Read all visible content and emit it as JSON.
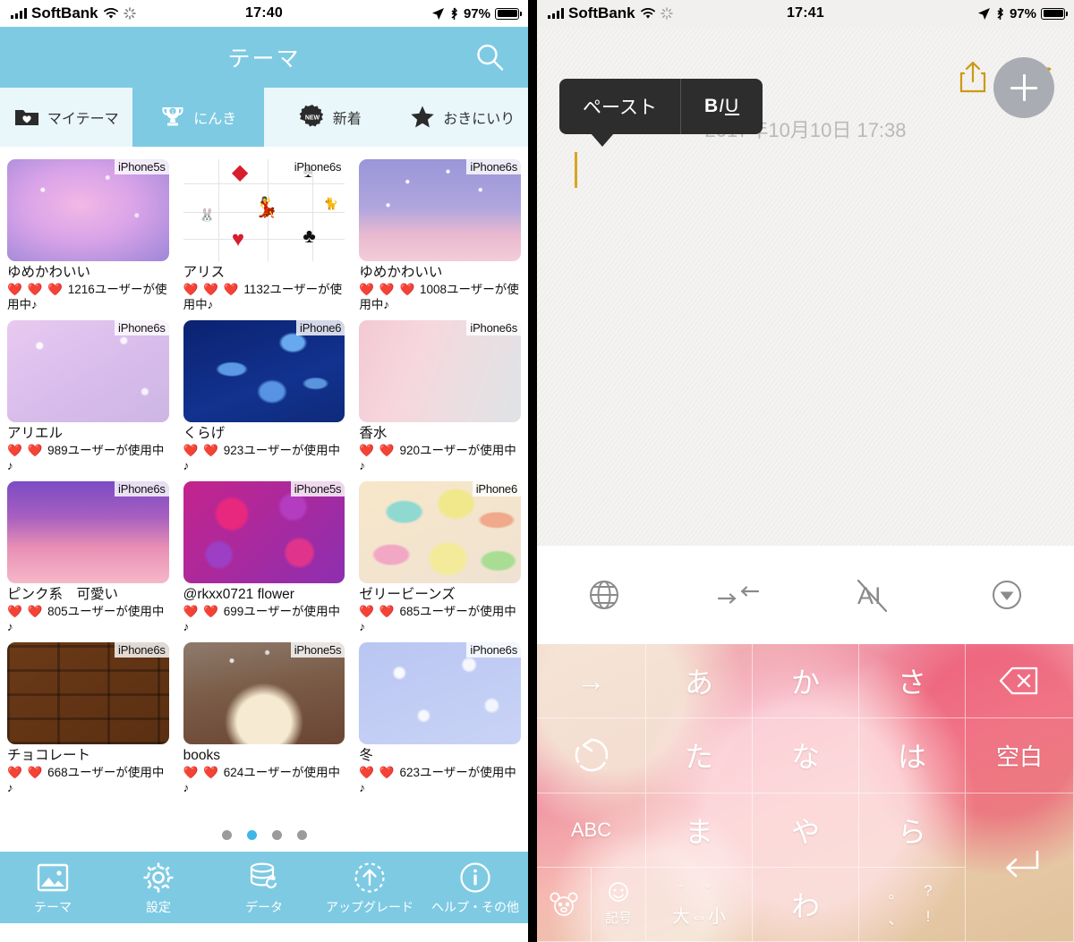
{
  "left_phone": {
    "statusbar": {
      "carrier": "SoftBank",
      "time": "17:40",
      "battery": "97%"
    },
    "header": {
      "title": "テーマ",
      "search_icon": "search-icon",
      "bg_color": "#7ecae3"
    },
    "tabs": [
      {
        "label": "マイテーマ",
        "icon": "folder-heart-icon",
        "active": false
      },
      {
        "label": "にんき",
        "icon": "trophy-icon",
        "active": true
      },
      {
        "label": "新着",
        "icon": "new-badge-icon",
        "active": false
      },
      {
        "label": "おきにいり",
        "icon": "star-icon",
        "active": false
      }
    ],
    "themes": [
      {
        "name": "ゆめかわいい",
        "device": "iPhone5s",
        "hearts": 3,
        "users": "1216ユーザーが使用中♪",
        "art": "t-yume1"
      },
      {
        "name": "アリス",
        "device": "iPhone6s",
        "hearts": 3,
        "users": "1132ユーザーが使用中♪",
        "art": "t-alice"
      },
      {
        "name": "ゆめかわいい",
        "device": "iPhone6s",
        "hearts": 3,
        "users": "1008ユーザーが使用中♪",
        "art": "t-yume2"
      },
      {
        "name": "アリエル",
        "device": "iPhone6s",
        "hearts": 2,
        "users": "989ユーザーが使用中♪",
        "art": "t-ariel"
      },
      {
        "name": "くらげ",
        "device": "iPhone6",
        "hearts": 2,
        "users": "923ユーザーが使用中♪",
        "art": "t-jelly"
      },
      {
        "name": "香水",
        "device": "iPhone6s",
        "hearts": 2,
        "users": "920ユーザーが使用中♪",
        "art": "t-perfume"
      },
      {
        "name": "ピンク系　可愛い",
        "device": "iPhone6s",
        "hearts": 2,
        "users": "805ユーザーが使用中♪",
        "art": "t-pink"
      },
      {
        "name": "@rkxx0721 flower",
        "device": "iPhone5s",
        "hearts": 2,
        "users": "699ユーザーが使用中♪",
        "art": "t-flower"
      },
      {
        "name": "ゼリービーンズ",
        "device": "iPhone6",
        "hearts": 2,
        "users": "685ユーザーが使用中♪",
        "art": "t-jellybean"
      },
      {
        "name": "チョコレート",
        "device": "iPhone6s",
        "hearts": 2,
        "users": "668ユーザーが使用中♪",
        "art": "t-choco"
      },
      {
        "name": "books",
        "device": "iPhone5s",
        "hearts": 2,
        "users": "624ユーザーが使用中♪",
        "art": "t-books"
      },
      {
        "name": "冬",
        "device": "iPhone6s",
        "hearts": 2,
        "users": "623ユーザーが使用中♪",
        "art": "t-winter"
      }
    ],
    "pager": {
      "count": 4,
      "active_index": 1,
      "active_color": "#41b6e6",
      "inactive_color": "#9b9b9b"
    },
    "tabbar": [
      {
        "label": "テーマ",
        "icon": "image-icon"
      },
      {
        "label": "設定",
        "icon": "gear-icon"
      },
      {
        "label": "データ",
        "icon": "database-refresh-icon"
      },
      {
        "label": "アップグレード",
        "icon": "upgrade-arrow-icon"
      },
      {
        "label": "ヘルプ・その他",
        "icon": "info-icon"
      }
    ]
  },
  "right_phone": {
    "statusbar": {
      "carrier": "SoftBank",
      "time": "17:41",
      "battery": "97%"
    },
    "note": {
      "date": "2017年10月10日 17:38",
      "share_icon": "share-icon",
      "done_label": "完了",
      "done_color": "#cc9a12",
      "add_button_icon": "plus-icon"
    },
    "context_menu": {
      "paste_label": "ペースト",
      "format_label": "BIU"
    },
    "keyboard_toolbar": [
      {
        "icon": "globe-icon"
      },
      {
        "icon": "cursor-move-icon"
      },
      {
        "icon": "ai-off-icon"
      },
      {
        "icon": "hide-keyboard-icon"
      }
    ],
    "keyboard": {
      "rows": [
        [
          {
            "label": "→",
            "name": "key-next",
            "kind": "sym"
          },
          {
            "label": "あ",
            "name": "key-a"
          },
          {
            "label": "か",
            "name": "key-ka"
          },
          {
            "label": "さ",
            "name": "key-sa"
          },
          {
            "label": "⌫",
            "name": "key-delete",
            "kind": "sym"
          }
        ],
        [
          {
            "label": "↺",
            "name": "key-undo",
            "kind": "sym"
          },
          {
            "label": "た",
            "name": "key-ta"
          },
          {
            "label": "な",
            "name": "key-na"
          },
          {
            "label": "は",
            "name": "key-ha"
          },
          {
            "label": "空白",
            "name": "key-space",
            "kind": "sp"
          }
        ],
        [
          {
            "label": "ABC",
            "name": "key-abc",
            "kind": "small"
          },
          {
            "label": "ま",
            "name": "key-ma"
          },
          {
            "label": "や",
            "name": "key-ya"
          },
          {
            "label": "ら",
            "name": "key-ra"
          },
          {
            "label": "",
            "name": "key-return",
            "kind": "ret"
          }
        ],
        [
          {
            "label": "",
            "name": "key-emoji-symbol",
            "kind": "split",
            "sub_left": "",
            "sub_right": "記号"
          },
          {
            "label": "大⇔小",
            "name": "key-case-toggle",
            "kind": "small",
            "sub": "゛　゜"
          },
          {
            "label": "わ",
            "name": "key-wa"
          },
          {
            "label": "",
            "name": "key-punctuation",
            "kind": "punct",
            "marks": [
              "。",
              "?",
              "、",
              "!"
            ]
          },
          {
            "label": "",
            "name": "key-return-span",
            "kind": "blank"
          }
        ]
      ]
    }
  }
}
